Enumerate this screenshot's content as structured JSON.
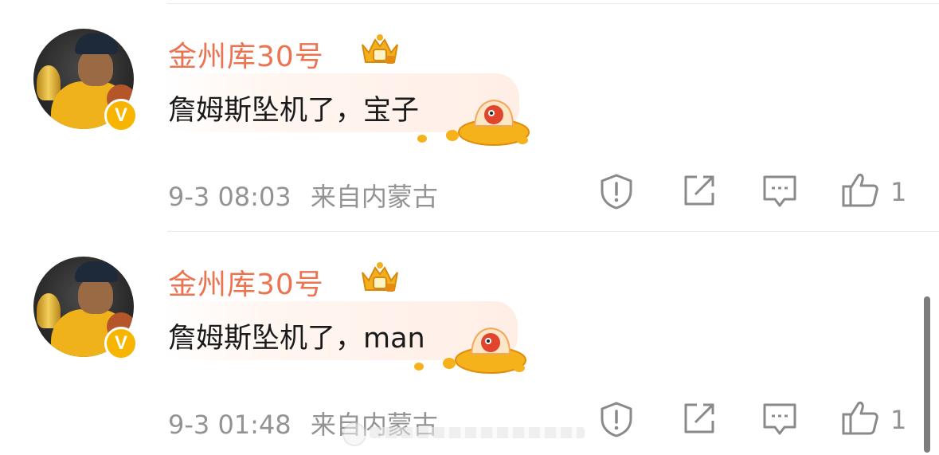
{
  "colors": {
    "username": "#eb7350",
    "meta_text": "#939393",
    "badge": "#f7b500"
  },
  "comments": [
    {
      "username": "金州库30号",
      "text": "詹姆斯坠机了，宝子",
      "time": "9-3 08:03",
      "location": "来自内蒙古",
      "like_count": "1",
      "badge_letter": "V"
    },
    {
      "username": "金州库30号",
      "text": "詹姆斯坠机了，man",
      "time": "9-3 01:48",
      "location": "来自内蒙古",
      "like_count": "1",
      "badge_letter": "V"
    }
  ],
  "icons": {
    "report": "report-icon",
    "share": "share-icon",
    "comment": "comment-icon",
    "like": "thumbs-up-icon",
    "crown": "crown-badge-icon",
    "sticker": "ufo-sticker-icon"
  }
}
